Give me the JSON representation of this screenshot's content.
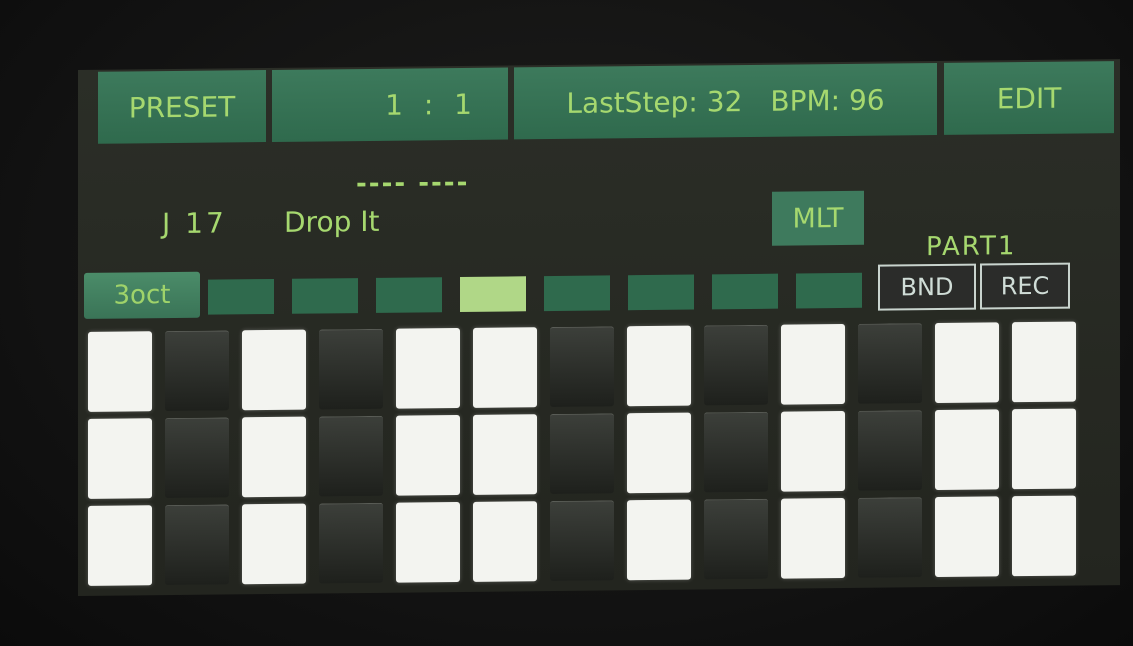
{
  "header": {
    "preset_label": "PRESET",
    "position": "1 : 1",
    "last_step": "LastStep: 32",
    "bpm": "BPM: 96",
    "edit_label": "EDIT"
  },
  "preset": {
    "number": "J 17",
    "name": "Drop It",
    "dashes": "---- ----"
  },
  "mlt_label": "MLT",
  "part_label": "PART1",
  "octave_label": "3oct",
  "bnd_label": "BND",
  "rec_label": "REC",
  "segments": {
    "count": 8,
    "active_index": 3
  },
  "keyboard": {
    "columns": 13,
    "rows": 3,
    "pattern": [
      "white",
      "black",
      "white",
      "black",
      "white",
      "white",
      "black",
      "white",
      "black",
      "white",
      "black",
      "white",
      "white"
    ]
  },
  "colors": {
    "accent_text": "#a6d86f",
    "button_green": "#2f6a4d",
    "active_segment": "#b0d787"
  }
}
